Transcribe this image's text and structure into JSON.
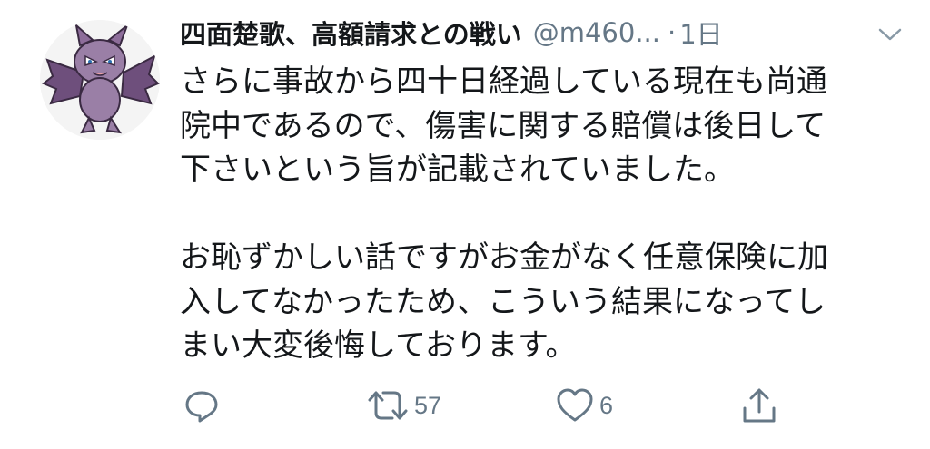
{
  "tweet": {
    "display_name": "四面楚歌、高額請求との戦い",
    "handle": "@m460...",
    "separator": "·",
    "time": "1日",
    "paragraphs": [
      [
        "さらに事故から四十日経過している現在も尚通",
        "院中であるので、傷害に関する賠償は後日して",
        "下さいという旨が記載されていました。"
      ],
      [
        "お恥ずかしい話ですがお金がなく任意保険に加",
        "入してなかったため、こういう結果になってし",
        "まい大変後悔しております。"
      ]
    ],
    "actions": {
      "retweet_count": "57",
      "like_count": "6"
    }
  },
  "icons": {
    "reply": "reply-icon",
    "retweet": "retweet-icon",
    "like": "heart-icon",
    "share": "share-icon",
    "menu": "chevron-down-icon"
  },
  "colors": {
    "text": "#14171a",
    "secondary": "#657786",
    "avatar_accent": "#7a5a86"
  }
}
